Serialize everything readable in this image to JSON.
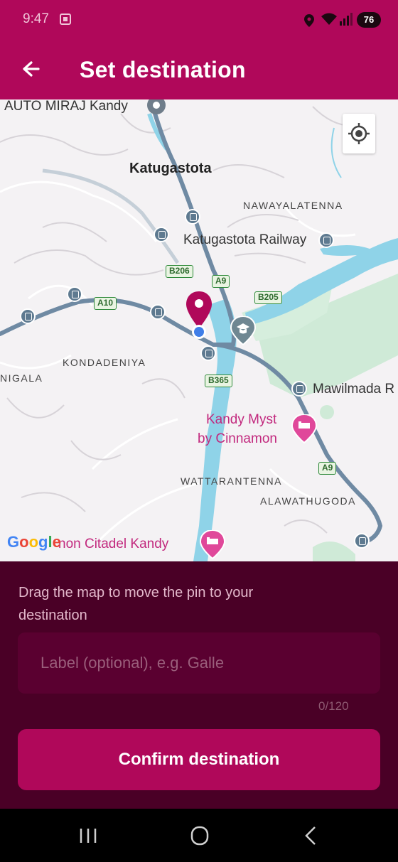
{
  "status_bar": {
    "time": "9:47",
    "battery": "76"
  },
  "app_bar": {
    "title": "Set destination"
  },
  "map": {
    "labels": {
      "auto_miraj": "AUTO MIRAJ Kandy",
      "katugastota": "Katugastota",
      "nawayalatenna": "NAWAYALATENNA",
      "katugastota_railway": "Katugastota Railway",
      "kondadeniya": "KONDADENIYA",
      "nigala": "NIGALA",
      "mawilmada": "Mawilmada R",
      "kandy_myst_1": "Kandy Myst",
      "kandy_myst_2": "by Cinnamon",
      "wattarantenna": "WATTARANTENNA",
      "alawathugoda": "ALAWATHUGODA",
      "citadel": "non Citadel Kandy"
    },
    "road_shields": {
      "b206": "B206",
      "a9_top": "A9",
      "a10": "A10",
      "b205": "B205",
      "b365": "B365",
      "a9_bottom": "A9"
    },
    "attribution": "Google"
  },
  "panel": {
    "instructions": "Drag the map to move the pin to your destination",
    "label_placeholder": "Label (optional), e.g. Galle",
    "label_value": "",
    "char_counter": "0/120",
    "confirm_label": "Confirm destination"
  },
  "colors": {
    "brand": "#b0085a",
    "panel": "#4a0026",
    "pin": "#b0085a"
  }
}
